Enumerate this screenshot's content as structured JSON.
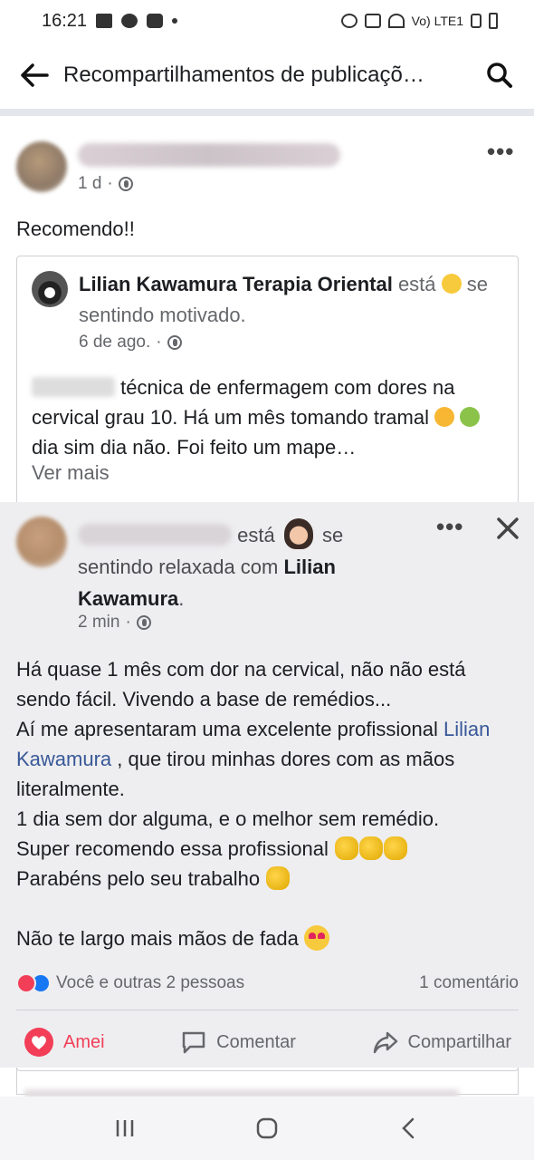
{
  "status_bar": {
    "time": "16:21",
    "network": "Vo) LTE1"
  },
  "appbar": {
    "title": "Recompartilhamentos de publicaçõ…"
  },
  "post": {
    "time": "1 d",
    "text": "Recomendo!!",
    "shared": {
      "author": "Lilian Kawamura Terapia Oriental",
      "feeling_prefix": "está",
      "feeling": "se sentindo motivado.",
      "time": "6 de ago.",
      "body_line1": "técnica de enfermagem com dores na cervical grau 10. Há um mês tomando tramal",
      "body_line2": " dia sim dia não. Foi feito um mape…",
      "see_more": "Ver mais"
    }
  },
  "overlay_post": {
    "feeling_prefix": "está",
    "feeling_suffix": "se sentindo relaxada com",
    "tagged": "Lilian Kawamura",
    "period": ".",
    "time": "2 min",
    "body": {
      "line1": "Há quase 1 mês com dor na cervical, não não está sendo fácil. Vivendo a base de remédios...",
      "line2": "Aí me apresentaram uma excelente profissional",
      "mention": "Lilian Kawamura",
      "line2_suffix": " , que tirou minhas dores com as mãos literalmente.",
      "line3": "1 dia sem dor alguma, e o melhor sem remédio.",
      "line4": "Super recomendo essa profissional ",
      "line5": "Parabéns pelo seu trabalho ",
      "line6": "Não te largo mais mãos de fada "
    },
    "reactions_text": "Você e outras 2 pessoas",
    "comments_text": "1 comentário",
    "actions": {
      "love": "Amei",
      "comment": "Comentar",
      "share": "Compartilhar"
    }
  },
  "colors": {
    "love": "#f33e58",
    "like": "#1877f2",
    "mention": "#385898",
    "meta": "#65676b"
  },
  "icons": [
    "back-arrow-icon",
    "search-icon",
    "globe-icon",
    "more-icon",
    "close-icon",
    "heart-icon",
    "comment-icon",
    "share-icon",
    "recents-icon",
    "home-icon",
    "back-nav-icon"
  ]
}
